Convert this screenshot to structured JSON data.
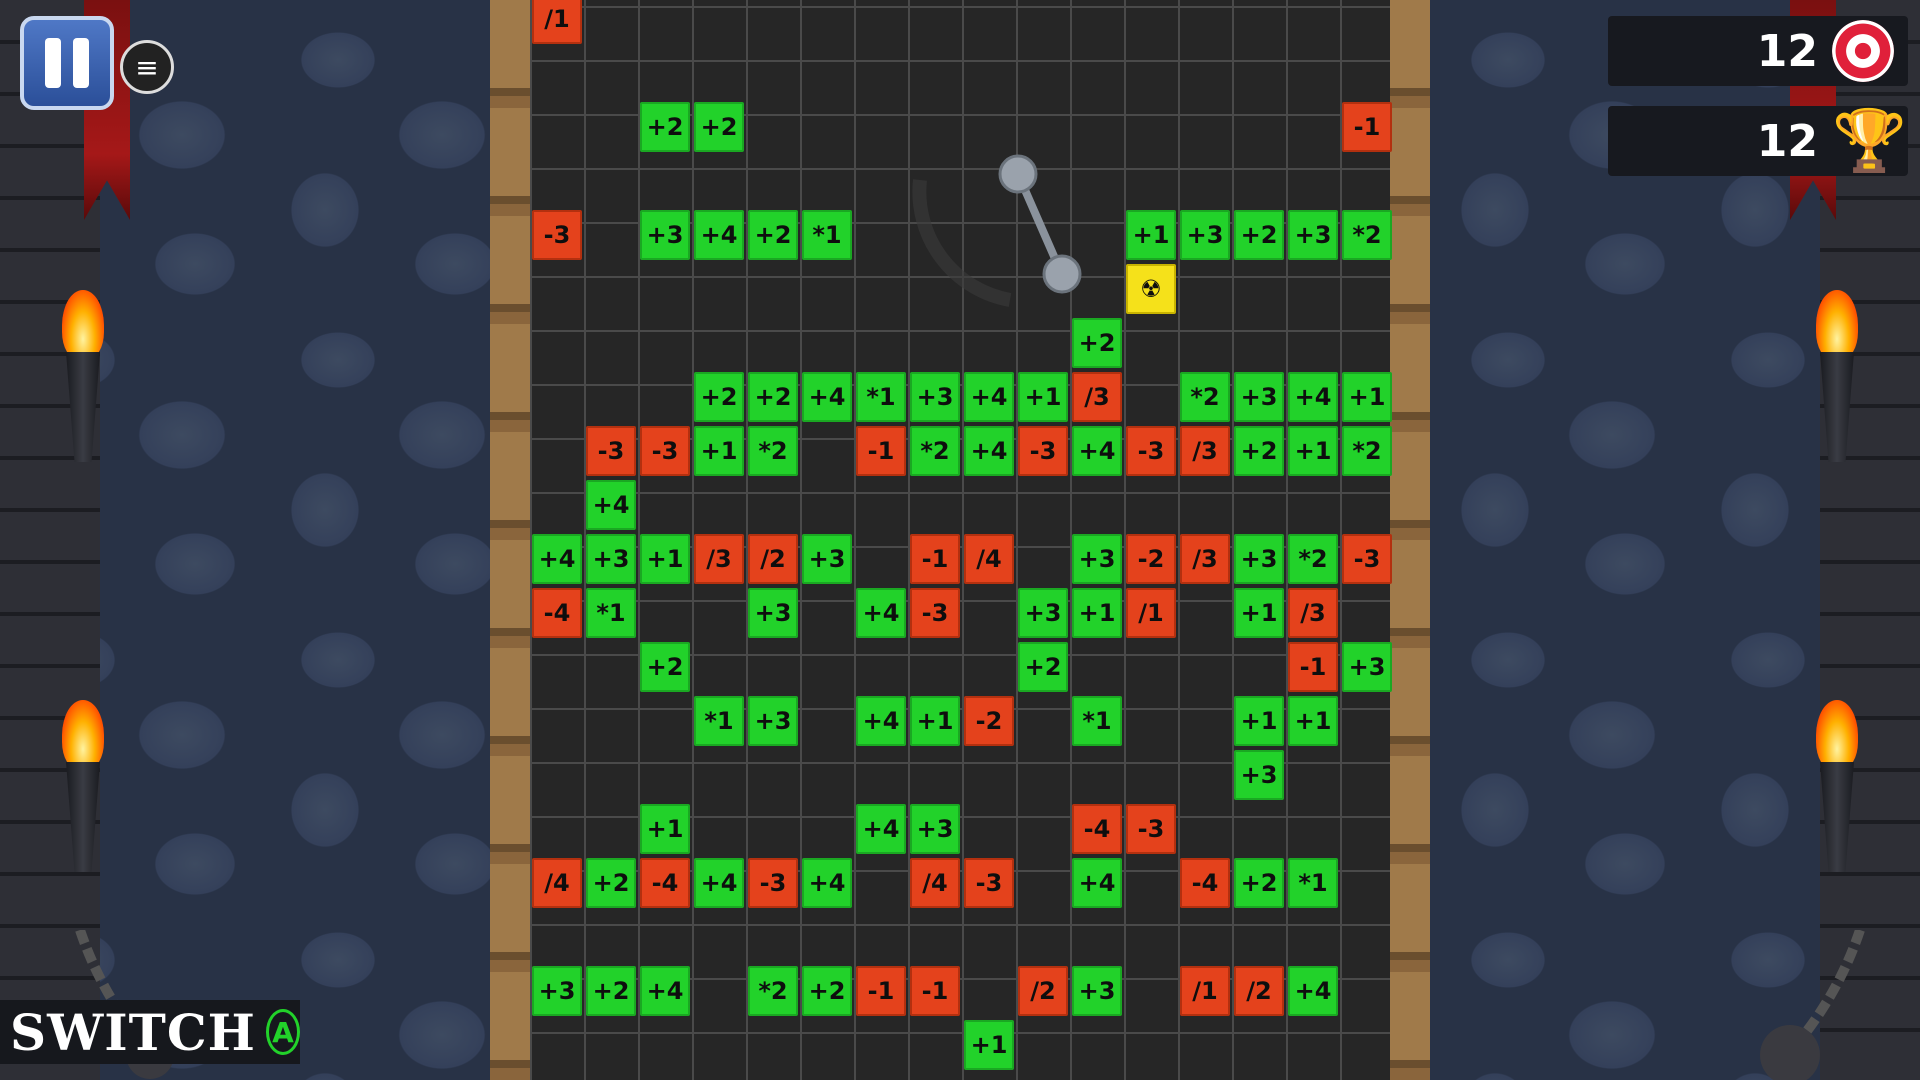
{
  "hud": {
    "target_count": "12",
    "trophy_count": "12",
    "switch_label": "SWITCH",
    "switch_button": "A",
    "target_icon": "target-icon",
    "trophy_icon": "trophy-icon",
    "pause_icon": "pause-icon",
    "menu_icon": "menu-icon"
  },
  "colors": {
    "positive_tile": "#22d22a",
    "negative_tile": "#e4421c",
    "hazard_tile": "#f5e11a"
  },
  "tiles": [
    {
      "t": "/1",
      "k": "r"
    },
    {
      "t": "+2",
      "k": "g"
    },
    {
      "t": "+2",
      "k": "g"
    },
    {
      "t": "-1",
      "k": "r"
    },
    {
      "t": "-3",
      "k": "r"
    },
    {
      "t": "+3",
      "k": "g"
    },
    {
      "t": "+4",
      "k": "g"
    },
    {
      "t": "+2",
      "k": "g"
    },
    {
      "t": "*1",
      "k": "g"
    },
    {
      "t": "+1",
      "k": "g"
    },
    {
      "t": "+3",
      "k": "g"
    },
    {
      "t": "+2",
      "k": "g"
    },
    {
      "t": "+3",
      "k": "g"
    },
    {
      "t": "*2",
      "k": "g"
    },
    {
      "t": "☢",
      "k": "y"
    },
    {
      "t": "+2",
      "k": "g"
    },
    {
      "t": "+2",
      "k": "g"
    },
    {
      "t": "+2",
      "k": "g"
    },
    {
      "t": "+4",
      "k": "g"
    },
    {
      "t": "*1",
      "k": "g"
    },
    {
      "t": "+3",
      "k": "g"
    },
    {
      "t": "+4",
      "k": "g"
    },
    {
      "t": "+1",
      "k": "g"
    },
    {
      "t": "/3",
      "k": "r"
    },
    {
      "t": "*2",
      "k": "g"
    },
    {
      "t": "+3",
      "k": "g"
    },
    {
      "t": "+4",
      "k": "g"
    },
    {
      "t": "+1",
      "k": "g"
    },
    {
      "t": "-3",
      "k": "r"
    },
    {
      "t": "-3",
      "k": "r"
    },
    {
      "t": "+1",
      "k": "g"
    },
    {
      "t": "*2",
      "k": "g"
    },
    {
      "t": "-1",
      "k": "r"
    },
    {
      "t": "*2",
      "k": "g"
    },
    {
      "t": "+4",
      "k": "g"
    },
    {
      "t": "-3",
      "k": "r"
    },
    {
      "t": "+4",
      "k": "g"
    },
    {
      "t": "-3",
      "k": "r"
    },
    {
      "t": "/3",
      "k": "r"
    },
    {
      "t": "+2",
      "k": "g"
    },
    {
      "t": "+1",
      "k": "g"
    },
    {
      "t": "*2",
      "k": "g"
    },
    {
      "t": "+4",
      "k": "g"
    },
    {
      "t": "+4",
      "k": "g"
    },
    {
      "t": "+3",
      "k": "g"
    },
    {
      "t": "+1",
      "k": "g"
    },
    {
      "t": "/3",
      "k": "r"
    },
    {
      "t": "/2",
      "k": "r"
    },
    {
      "t": "+3",
      "k": "g"
    },
    {
      "t": "-1",
      "k": "r"
    },
    {
      "t": "/4",
      "k": "r"
    },
    {
      "t": "+3",
      "k": "g"
    },
    {
      "t": "-2",
      "k": "r"
    },
    {
      "t": "/3",
      "k": "r"
    },
    {
      "t": "+3",
      "k": "g"
    },
    {
      "t": "*2",
      "k": "g"
    },
    {
      "t": "-3",
      "k": "r"
    },
    {
      "t": "-4",
      "k": "r"
    },
    {
      "t": "*1",
      "k": "g"
    },
    {
      "t": "+3",
      "k": "g"
    },
    {
      "t": "+4",
      "k": "g"
    },
    {
      "t": "-3",
      "k": "r"
    },
    {
      "t": "+3",
      "k": "g"
    },
    {
      "t": "+1",
      "k": "g"
    },
    {
      "t": "/1",
      "k": "r"
    },
    {
      "t": "+1",
      "k": "g"
    },
    {
      "t": "/3",
      "k": "r"
    },
    {
      "t": "+2",
      "k": "g"
    },
    {
      "t": "+2",
      "k": "g"
    },
    {
      "t": "-1",
      "k": "r"
    },
    {
      "t": "+3",
      "k": "g"
    },
    {
      "t": "*1",
      "k": "g"
    },
    {
      "t": "+3",
      "k": "g"
    },
    {
      "t": "+4",
      "k": "g"
    },
    {
      "t": "+1",
      "k": "g"
    },
    {
      "t": "-2",
      "k": "r"
    },
    {
      "t": "*1",
      "k": "g"
    },
    {
      "t": "+1",
      "k": "g"
    },
    {
      "t": "+1",
      "k": "g"
    },
    {
      "t": "+3",
      "k": "g"
    },
    {
      "t": "+1",
      "k": "g"
    },
    {
      "t": "+4",
      "k": "g"
    },
    {
      "t": "+3",
      "k": "g"
    },
    {
      "t": "-4",
      "k": "r"
    },
    {
      "t": "-3",
      "k": "r"
    },
    {
      "t": "/4",
      "k": "r"
    },
    {
      "t": "+2",
      "k": "g"
    },
    {
      "t": "-4",
      "k": "r"
    },
    {
      "t": "+4",
      "k": "g"
    },
    {
      "t": "-3",
      "k": "r"
    },
    {
      "t": "+4",
      "k": "g"
    },
    {
      "t": "/4",
      "k": "r"
    },
    {
      "t": "-3",
      "k": "r"
    },
    {
      "t": "+4",
      "k": "g"
    },
    {
      "t": "-4",
      "k": "r"
    },
    {
      "t": "+2",
      "k": "g"
    },
    {
      "t": "*1",
      "k": "g"
    },
    {
      "t": "+3",
      "k": "g"
    },
    {
      "t": "+2",
      "k": "g"
    },
    {
      "t": "+4",
      "k": "g"
    },
    {
      "t": "*2",
      "k": "g"
    },
    {
      "t": "+2",
      "k": "g"
    },
    {
      "t": "-1",
      "k": "r"
    },
    {
      "t": "-1",
      "k": "r"
    },
    {
      "t": "/2",
      "k": "r"
    },
    {
      "t": "+3",
      "k": "g"
    },
    {
      "t": "/1",
      "k": "r"
    },
    {
      "t": "/2",
      "k": "r"
    },
    {
      "t": "+4",
      "k": "g"
    },
    {
      "t": "+1",
      "k": "g"
    }
  ]
}
